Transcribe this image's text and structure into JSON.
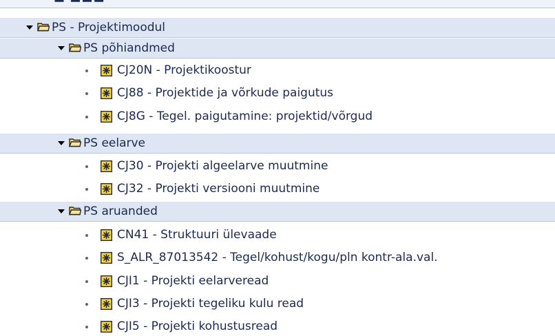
{
  "tree": {
    "top_partial_label": "▬ ▬▬▬",
    "root": {
      "label": "PS - Projektimoodul",
      "expanded": true,
      "icon": "folder-open-icon"
    },
    "groups": [
      {
        "label": "PS põhiandmed",
        "expanded": true,
        "icon": "folder-open-icon",
        "items": [
          {
            "label": "CJ20N - Projektikoostur",
            "icon": "transaction-icon"
          },
          {
            "label": "CJ88 - Projektide ja võrkude paigutus",
            "icon": "transaction-icon"
          },
          {
            "label": "CJ8G - Tegel. paigutamine: projektid/võrgud",
            "icon": "transaction-icon"
          }
        ]
      },
      {
        "label": "PS eelarve",
        "expanded": true,
        "icon": "folder-open-icon",
        "items": [
          {
            "label": "CJ30 - Projekti algeelarve muutmine",
            "icon": "transaction-icon"
          },
          {
            "label": "CJ32 - Projekti versiooni muutmine",
            "icon": "transaction-icon"
          }
        ]
      },
      {
        "label": "PS aruanded",
        "expanded": true,
        "icon": "folder-open-icon",
        "items": [
          {
            "label": "CN41 - Struktuuri ülevaade",
            "icon": "transaction-icon"
          },
          {
            "label": "S_ALR_87013542 - Tegel/kohust/kogu/pln kontr-ala.val.",
            "icon": "transaction-icon"
          },
          {
            "label": "CJI1 - Projekti eelarveread",
            "icon": "transaction-icon"
          },
          {
            "label": "CJI3 - Projekti tegeliku kulu read",
            "icon": "transaction-icon"
          },
          {
            "label": "CJI5 - Projekti kohustusread",
            "icon": "transaction-icon"
          }
        ]
      }
    ],
    "colors": {
      "folder_row_bg": "#dde6f2",
      "text": "#1c2a52",
      "folder_fill": "#f6d36a",
      "folder_stroke": "#2b2b2b",
      "tx_icon_fill": "#f4d44a"
    }
  }
}
